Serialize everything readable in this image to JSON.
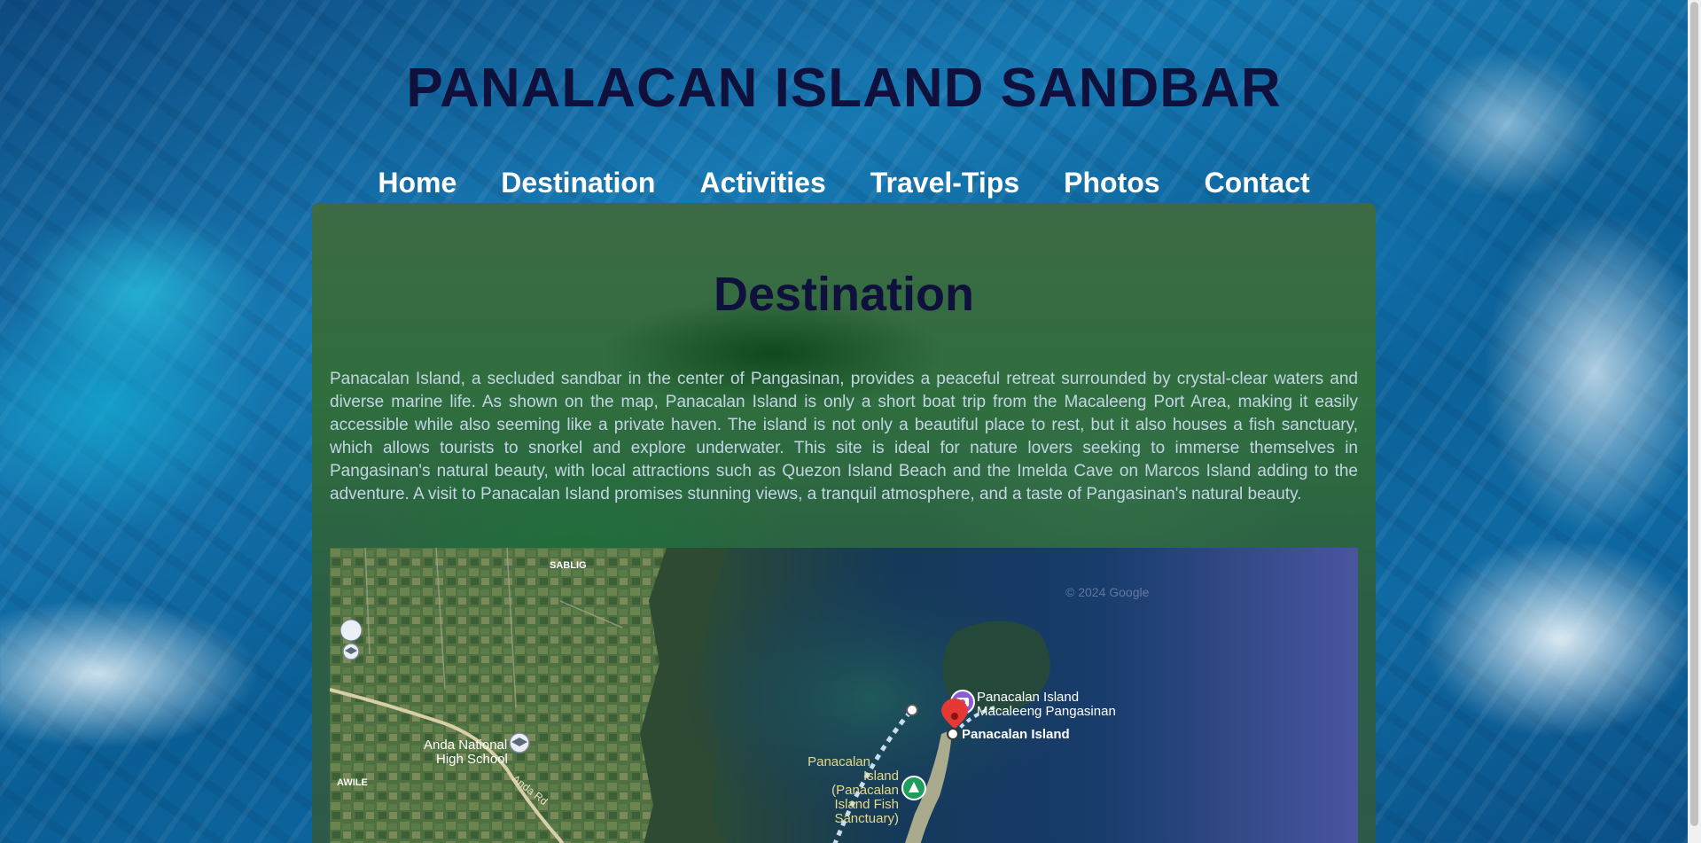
{
  "header": {
    "title": "PANALACAN ISLAND SANDBAR"
  },
  "nav": {
    "items": [
      {
        "label": "Home"
      },
      {
        "label": "Destination"
      },
      {
        "label": "Activities"
      },
      {
        "label": "Travel-Tips"
      },
      {
        "label": "Photos"
      },
      {
        "label": "Contact"
      }
    ]
  },
  "section": {
    "heading": "Destination",
    "paragraph": "Panacalan Island, a secluded sandbar in the center of Pangasinan, provides a peaceful retreat surrounded by crystal-clear waters and diverse marine life. As shown on the map, Panacalan Island is only a short boat trip from the Macaleeng Port Area, making it easily accessible while also seeming like a private haven. The island is not only a beautiful place to rest, but it also houses a fish sanctuary, which allows tourists to snorkel and explore underwater. This site is ideal for nature lovers seeking to immerse themselves in Pangasinan's natural beauty, with local attractions such as Quezon Island Beach and the Imelda Cave on Marcos Island adding to the adventure. A visit to Panacalan Island promises stunning views, a tranquil atmosphere, and a taste of Pangasinan's natural beauty."
  },
  "map": {
    "copyright": "© 2024 Google",
    "labels": {
      "sablig": "SABLIG",
      "awile": "AWILE",
      "school_line1": "Anda National",
      "school_line2": "High School",
      "road": "Anda Rd",
      "place_line1": "Panacalan Island",
      "place_line2": "Macaleeng Pangasinan",
      "island": "Panacalan Island",
      "sanctuary_line1": "Panacalan",
      "sanctuary_line2": "Island",
      "sanctuary_line3": "(Panacalan",
      "sanctuary_line4": "Island Fish",
      "sanctuary_line5": "Sanctuary)"
    },
    "icons": {
      "school": "school-icon",
      "camera": "camera-icon",
      "pin": "location-pin-icon",
      "park": "park-icon"
    },
    "colors": {
      "pin": "#e53935",
      "camera_marker": "#8e5bd6",
      "park_marker": "#1e9e5a",
      "route": "#c9ddf2"
    }
  }
}
